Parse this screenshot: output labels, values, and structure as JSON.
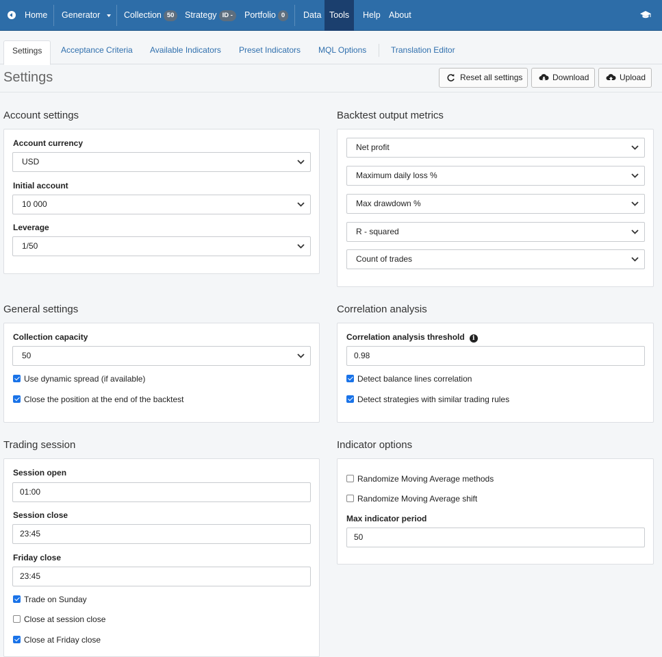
{
  "nav": {
    "home": "Home",
    "generator": "Generator",
    "collection": "Collection",
    "collection_count": "50",
    "strategy": "Strategy",
    "strategy_badge": "ID -",
    "portfolio": "Portfolio",
    "portfolio_count": "0",
    "data": "Data",
    "tools": "Tools",
    "help": "Help",
    "about": "About"
  },
  "tabs": [
    "Settings",
    "Acceptance Criteria",
    "Available Indicators",
    "Preset Indicators",
    "MQL Options",
    "Translation Editor"
  ],
  "header": {
    "title": "Settings",
    "reset": "Reset all settings",
    "download": "Download",
    "upload": "Upload"
  },
  "account": {
    "title": "Account settings",
    "currency_label": "Account currency",
    "currency": "USD",
    "initial_label": "Initial account",
    "initial": "10 000",
    "leverage_label": "Leverage",
    "leverage": "1/50"
  },
  "metrics": {
    "title": "Backtest output metrics",
    "items": [
      "Net profit",
      "Maximum daily loss %",
      "Max drawdown %",
      "R - squared",
      "Count of trades"
    ]
  },
  "general": {
    "title": "General settings",
    "capacity_label": "Collection capacity",
    "capacity": "50",
    "dynamic_spread": "Use dynamic spread (if available)",
    "close_end": "Close the position at the end of the backtest"
  },
  "correlation": {
    "title": "Correlation analysis",
    "threshold_label": "Correlation analysis threshold",
    "threshold": "0.98",
    "balance_lines": "Detect balance lines correlation",
    "similar_rules": "Detect strategies with similar trading rules"
  },
  "session": {
    "title": "Trading session",
    "open_label": "Session open",
    "open": "01:00",
    "close_label": "Session close",
    "close": "23:45",
    "friday_label": "Friday close",
    "friday": "23:45",
    "trade_sunday": "Trade on Sunday",
    "close_session": "Close at session close",
    "close_friday": "Close at Friday close"
  },
  "indicator": {
    "title": "Indicator options",
    "randomize_methods": "Randomize Moving Average methods",
    "randomize_shift": "Randomize Moving Average shift",
    "max_period_label": "Max indicator period",
    "max_period": "50"
  },
  "colors": {
    "navbar": "#2d6da8",
    "navbar_active": "#1b3f6e",
    "link": "#2f6fad",
    "checkbox": "#1a73e8"
  }
}
